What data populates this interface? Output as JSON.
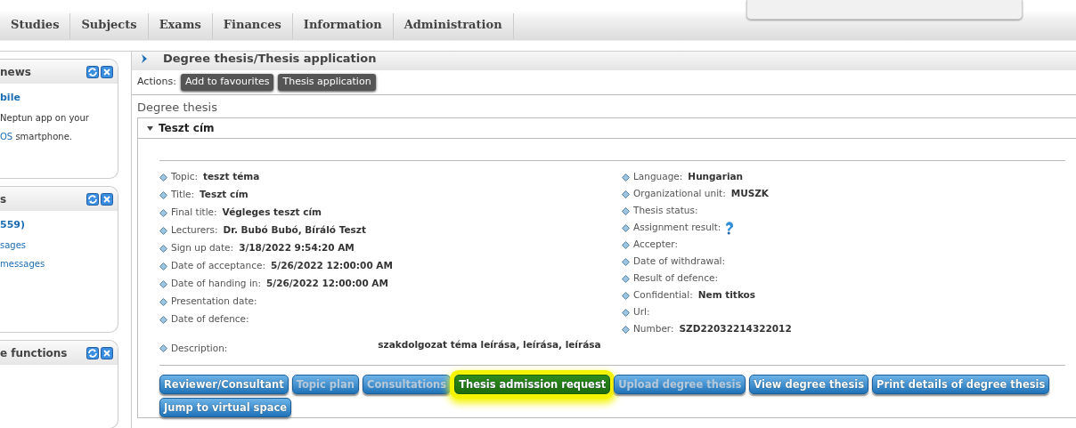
{
  "top_menu": [
    {
      "label": "Studies"
    },
    {
      "label": "Subjects"
    },
    {
      "label": "Exams"
    },
    {
      "label": "Finances"
    },
    {
      "label": "Information"
    },
    {
      "label": "Administration"
    }
  ],
  "sidebar": [
    {
      "title": "news",
      "lines": [
        {
          "text": "bile",
          "kind": "link"
        },
        {
          "text": "Neptun app on your",
          "kind": "text"
        },
        {
          "text": "OS",
          "kind": "link",
          "tail": " smartphone."
        }
      ]
    },
    {
      "title": "s",
      "lines": [
        {
          "text": "559)",
          "kind": "link"
        },
        {
          "text": "sages",
          "kind": "item"
        },
        {
          "text": "messages",
          "kind": "item"
        }
      ]
    },
    {
      "title": "e functions"
    }
  ],
  "page_title": "Degree thesis/Thesis application",
  "actions": {
    "label": "Actions:",
    "buttons": [
      "Add to favourites",
      "Thesis application"
    ]
  },
  "section_title": "Degree thesis",
  "thesis": {
    "title": "Teszt cím",
    "expanded": true,
    "left_fields": [
      {
        "label": "Topic:",
        "value": "teszt téma"
      },
      {
        "label": "Title:",
        "value": "Teszt cím"
      },
      {
        "label": "Final title:",
        "value": "Végleges teszt cím"
      },
      {
        "label": "Lecturers:",
        "value": "Dr. Bubó Bubó, Bíráló Teszt"
      },
      {
        "label": "Sign up date:",
        "value": "3/18/2022 9:54:20 AM"
      },
      {
        "label": "Date of acceptance:",
        "value": "5/26/2022 12:00:00 AM"
      },
      {
        "label": "Date of handing in:",
        "value": "5/26/2022 12:00:00 AM"
      },
      {
        "label": "Presentation date:"
      },
      {
        "label": "Date of defence:"
      }
    ],
    "right_fields": [
      {
        "label": "Language:",
        "value": "Hungarian"
      },
      {
        "label": "Organizational unit:",
        "value": "MUSZK"
      },
      {
        "label": "Thesis status:"
      },
      {
        "label": "Assignment result:",
        "kind": "help"
      },
      {
        "label": "Accepter:"
      },
      {
        "label": "Date of withdrawal:"
      },
      {
        "label": "Result of defence:"
      },
      {
        "label": "Confidential:",
        "value": "Nem titkos"
      },
      {
        "label": "Url:"
      },
      {
        "label": "Number:",
        "value": "SZD22032214322012"
      }
    ],
    "description": {
      "label": "Description:",
      "value": "szakdolgozat téma leírása, leírása, leírása"
    },
    "buttons": [
      {
        "label": "Reviewer/Consultant",
        "disabled": false,
        "highlighted": false
      },
      {
        "label": "Topic plan",
        "disabled": true,
        "highlighted": false
      },
      {
        "label": "Consultations",
        "disabled": true,
        "highlighted": false
      },
      {
        "label": "Thesis admission request",
        "disabled": false,
        "highlighted": true
      },
      {
        "label": "Upload degree thesis",
        "disabled": true,
        "highlighted": false
      },
      {
        "label": "View degree thesis",
        "disabled": false,
        "highlighted": false
      },
      {
        "label": "Print details of degree thesis",
        "disabled": false,
        "highlighted": false
      },
      {
        "label": "Jump to virtual space",
        "disabled": false,
        "highlighted": false
      }
    ]
  }
}
